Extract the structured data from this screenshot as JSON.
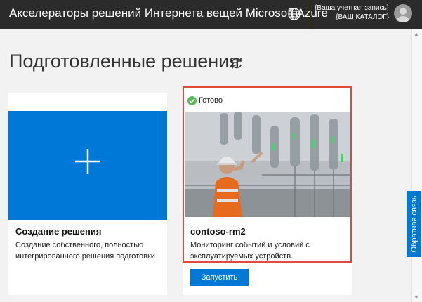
{
  "header": {
    "title": "Акселераторы решений Интернета вещей Microsoft Azure",
    "account_line1": "{Ваша учетная запись}",
    "account_line2": "{ВАШ КАТАЛОГ}",
    "globe_icon": "globe-icon",
    "avatar_icon": "user-avatar-icon"
  },
  "main": {
    "page_title": "Подготовленные решения",
    "refresh_icon": "refresh-icon"
  },
  "cards": [
    {
      "title": "Создание решения",
      "description": "Создание собственного, полностью интегрированного решения подготовки",
      "tile_color": "#0078d7",
      "icon": "plus-icon"
    },
    {
      "status": "Готово",
      "status_icon": "check-circle-icon",
      "title": "contoso-rm2",
      "description": "Мониторинг событий и условий с эксплуатируемых устройств.",
      "button_label": "Запустить",
      "highlight_color": "#e04a3a"
    }
  ],
  "feedback": {
    "label": "Обратная связь"
  },
  "colors": {
    "accent": "#0078d7",
    "topbar": "#2b2b2b",
    "status_ok": "#5cb85c"
  }
}
